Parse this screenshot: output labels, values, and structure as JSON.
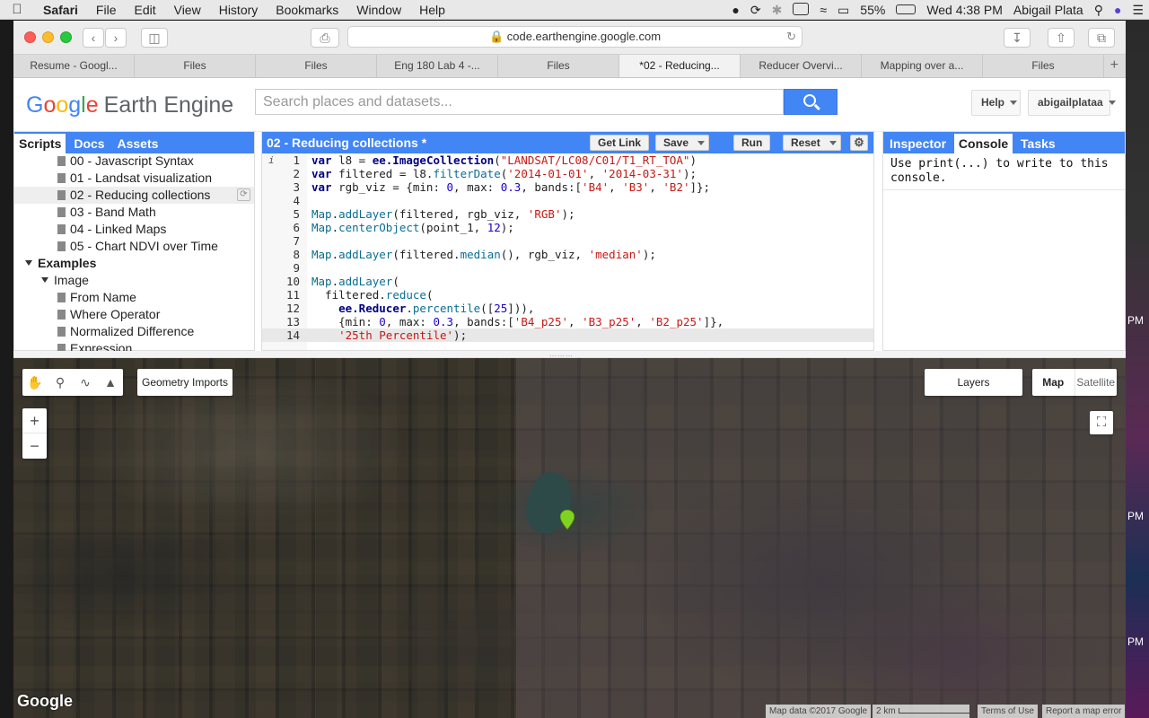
{
  "menubar": {
    "app": "Safari",
    "items": [
      "File",
      "Edit",
      "View",
      "History",
      "Bookmarks",
      "Window",
      "Help"
    ],
    "battery": "55%",
    "clock": "Wed 4:38 PM",
    "user": "Abigail Plata"
  },
  "desktop_peek": [
    "PM",
    "PM",
    "PM"
  ],
  "browser": {
    "url": "code.earthengine.google.com",
    "tabs": [
      {
        "label": "Resume - Googl..."
      },
      {
        "label": "Files"
      },
      {
        "label": "Files"
      },
      {
        "label": "Eng 180 Lab 4 -..."
      },
      {
        "label": "Files"
      },
      {
        "label": "*02 - Reducing..."
      },
      {
        "label": "Reducer Overvi..."
      },
      {
        "label": "Mapping over a..."
      },
      {
        "label": "Files"
      }
    ],
    "new_tab": "+"
  },
  "ee_header": {
    "logo_google": [
      "G",
      "o",
      "o",
      "g",
      "l",
      "e"
    ],
    "logo_product": "Earth Engine",
    "search_placeholder": "Search places and datasets...",
    "help_label": "Help",
    "user_label": "abigailplataa"
  },
  "left_panel": {
    "tabs": [
      "Scripts",
      "Docs",
      "Assets"
    ],
    "scripts": [
      "00 - Javascript Syntax",
      "01 - Landsat visualization",
      "02 - Reducing collections",
      "03 - Band Math",
      "04 - Linked Maps",
      "05 - Chart NDVI over Time"
    ],
    "examples_label": "Examples",
    "image_label": "Image",
    "image_items": [
      "From Name",
      "Where Operator",
      "Normalized Difference",
      "Expression"
    ]
  },
  "editor": {
    "title": "02 - Reducing collections *",
    "get_link": "Get Link",
    "save": "Save",
    "run": "Run",
    "reset": "Reset",
    "info_marker": "i",
    "line_numbers": [
      "1",
      "2",
      "3",
      "4",
      "5",
      "6",
      "7",
      "8",
      "9",
      "10",
      "11",
      "12",
      "13",
      "14"
    ],
    "lines": [
      "var l8 = ee.ImageCollection(\"LANDSAT/LC08/C01/T1_RT_TOA\")",
      "var filtered = l8.filterDate('2014-01-01', '2014-03-31');",
      "var rgb_viz = {min: 0, max: 0.3, bands:['B4', 'B3', 'B2']};",
      "",
      "Map.addLayer(filtered, rgb_viz, 'RGB');",
      "Map.centerObject(point_1, 12);",
      "",
      "Map.addLayer(filtered.median(), rgb_viz, 'median');",
      "",
      "Map.addLayer(",
      "  filtered.reduce(",
      "    ee.Reducer.percentile([25])),",
      "    {min: 0, max: 0.3, bands:['B4_p25', 'B3_p25', 'B2_p25']},",
      "    '25th Percentile');"
    ]
  },
  "right_panel": {
    "tabs": [
      "Inspector",
      "Console",
      "Tasks"
    ],
    "console_text": "Use print(...) to write to this console."
  },
  "map": {
    "geometry_imports": "Geometry Imports",
    "layers": "Layers",
    "map_type_map": "Map",
    "map_type_satellite": "Satellite",
    "zoom_in": "+",
    "zoom_out": "−",
    "google_logo": "Google",
    "map_data": "Map data ©2017 Google",
    "scale": "2 km",
    "terms": "Terms of Use",
    "report": "Report a map error",
    "marker_color": "#7ed321"
  }
}
